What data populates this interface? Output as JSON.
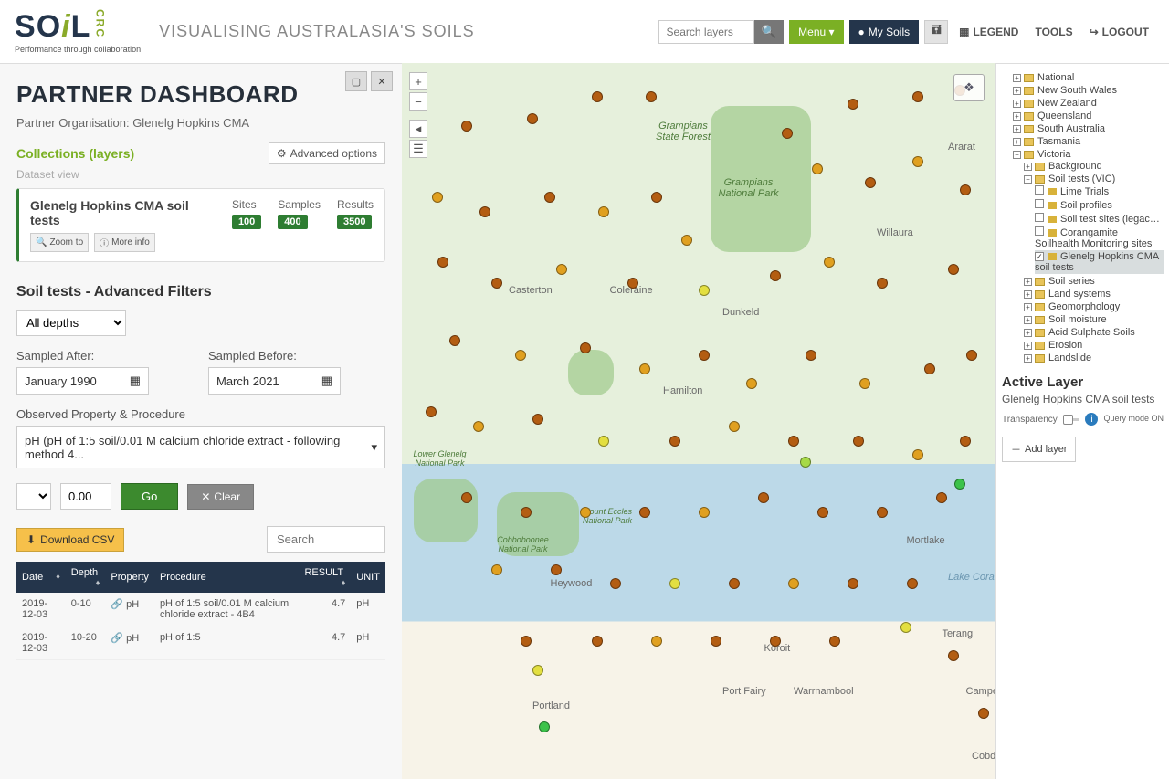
{
  "header": {
    "app_title": "VISUALISING AUSTRALASIA'S SOILS",
    "logo_sub": "Performance through collaboration",
    "search_placeholder": "Search layers",
    "menu_label": "Menu ▾",
    "mysoils_label": "My Soils",
    "legend_label": "LEGEND",
    "tools_label": "TOOLS",
    "logout_label": "LOGOUT"
  },
  "dashboard": {
    "title": "PARTNER DASHBOARD",
    "org_prefix": "Partner Organisation: ",
    "org_name": "Glenelg Hopkins CMA",
    "collections_label": "Collections (layers)",
    "adv_options_label": "Advanced options",
    "dataset_view_label": "Dataset view",
    "dataset": {
      "name": "Glenelg Hopkins CMA soil tests",
      "zoom_label": "Zoom to",
      "info_label": "More info",
      "sites_label": "Sites",
      "sites_value": "100",
      "samples_label": "Samples",
      "samples_value": "400",
      "results_label": "Results",
      "results_value": "3500"
    }
  },
  "filters": {
    "title": "Soil tests - Advanced Filters",
    "depth_value": "All depths",
    "after_label": "Sampled After:",
    "after_value": "January 1990",
    "before_label": "Sampled Before:",
    "before_value": "March 2021",
    "obs_label": "Observed Property & Procedure",
    "obs_value": "pH (pH of 1:5 soil/0.01 M calcium chloride extract - following method 4...",
    "op_value": ">",
    "num_value": "0.00",
    "go_label": "Go",
    "clear_label": "Clear"
  },
  "table": {
    "download_label": "Download CSV",
    "search_placeholder": "Search",
    "headers": {
      "date": "Date",
      "depth": "Depth",
      "property": "Property",
      "procedure": "Procedure",
      "result": "RESULT",
      "unit": "UNIT"
    },
    "rows": [
      {
        "date": "2019-12-03",
        "depth": "0-10",
        "property": "pH",
        "procedure": "pH of 1:5 soil/0.01 M calcium chloride extract - 4B4",
        "result": "4.7",
        "unit": "pH"
      },
      {
        "date": "2019-12-03",
        "depth": "10-20",
        "property": "pH",
        "procedure": "pH of 1:5",
        "result": "4.7",
        "unit": "pH"
      }
    ]
  },
  "map": {
    "labels": [
      "Casterton",
      "Coleraine",
      "Dunkeld",
      "Ararat",
      "Hamilton",
      "Willaura",
      "Heywood",
      "Portland",
      "Port Fairy",
      "Warrnambool",
      "Koroit",
      "Mortlake",
      "Terang",
      "Camperdown",
      "Cobden",
      "Lake Corangamite",
      "Grampians National Park",
      "Grampians State Forest",
      "Mount Eccles National Park",
      "Cobboboonee National Park",
      "Lower Glenelg National Park"
    ]
  },
  "tree": {
    "national": "National",
    "nsw": "New South Wales",
    "nz": "New Zealand",
    "qld": "Queensland",
    "sa": "South Australia",
    "tas": "Tasmania",
    "vic": "Victoria",
    "bg": "Background",
    "soiltests": "Soil tests (VIC)",
    "lime": "Lime Trials",
    "profiles": "Soil profiles",
    "legacy": "Soil test sites (legacy viewer)",
    "corang": "Corangamite Soilhealth Monitoring sites",
    "ghcma": "Glenelg Hopkins CMA soil tests",
    "soilseries": "Soil series",
    "landsys": "Land systems",
    "geomorph": "Geomorphology",
    "soilmoist": "Soil moisture",
    "acidsulf": "Acid Sulphate Soils",
    "erosion": "Erosion",
    "landslide": "Landslide"
  },
  "active": {
    "title": "Active Layer",
    "name": "Glenelg Hopkins CMA soil tests",
    "transparency_label": "Transparency",
    "query_mode": "Query mode ON",
    "add_layer": "Add layer"
  }
}
